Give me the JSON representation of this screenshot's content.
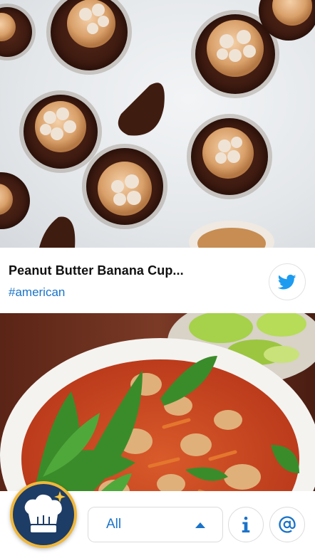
{
  "feed": {
    "cards": [
      {
        "title": "Peanut Butter Banana Cup...",
        "tag": "#american",
        "share_icon": "twitter-icon"
      },
      {
        "image": "stir-fry-photo"
      }
    ]
  },
  "bottom_bar": {
    "logo_icon": "chef-hat-icon",
    "filter": {
      "selected": "All"
    },
    "info_icon": "info-icon",
    "at_icon": "at-icon"
  },
  "colors": {
    "accent": "#1a73c9",
    "logo_bg": "#1d3c66",
    "logo_ring": "#f0b73a",
    "twitter": "#1d9bf0"
  }
}
